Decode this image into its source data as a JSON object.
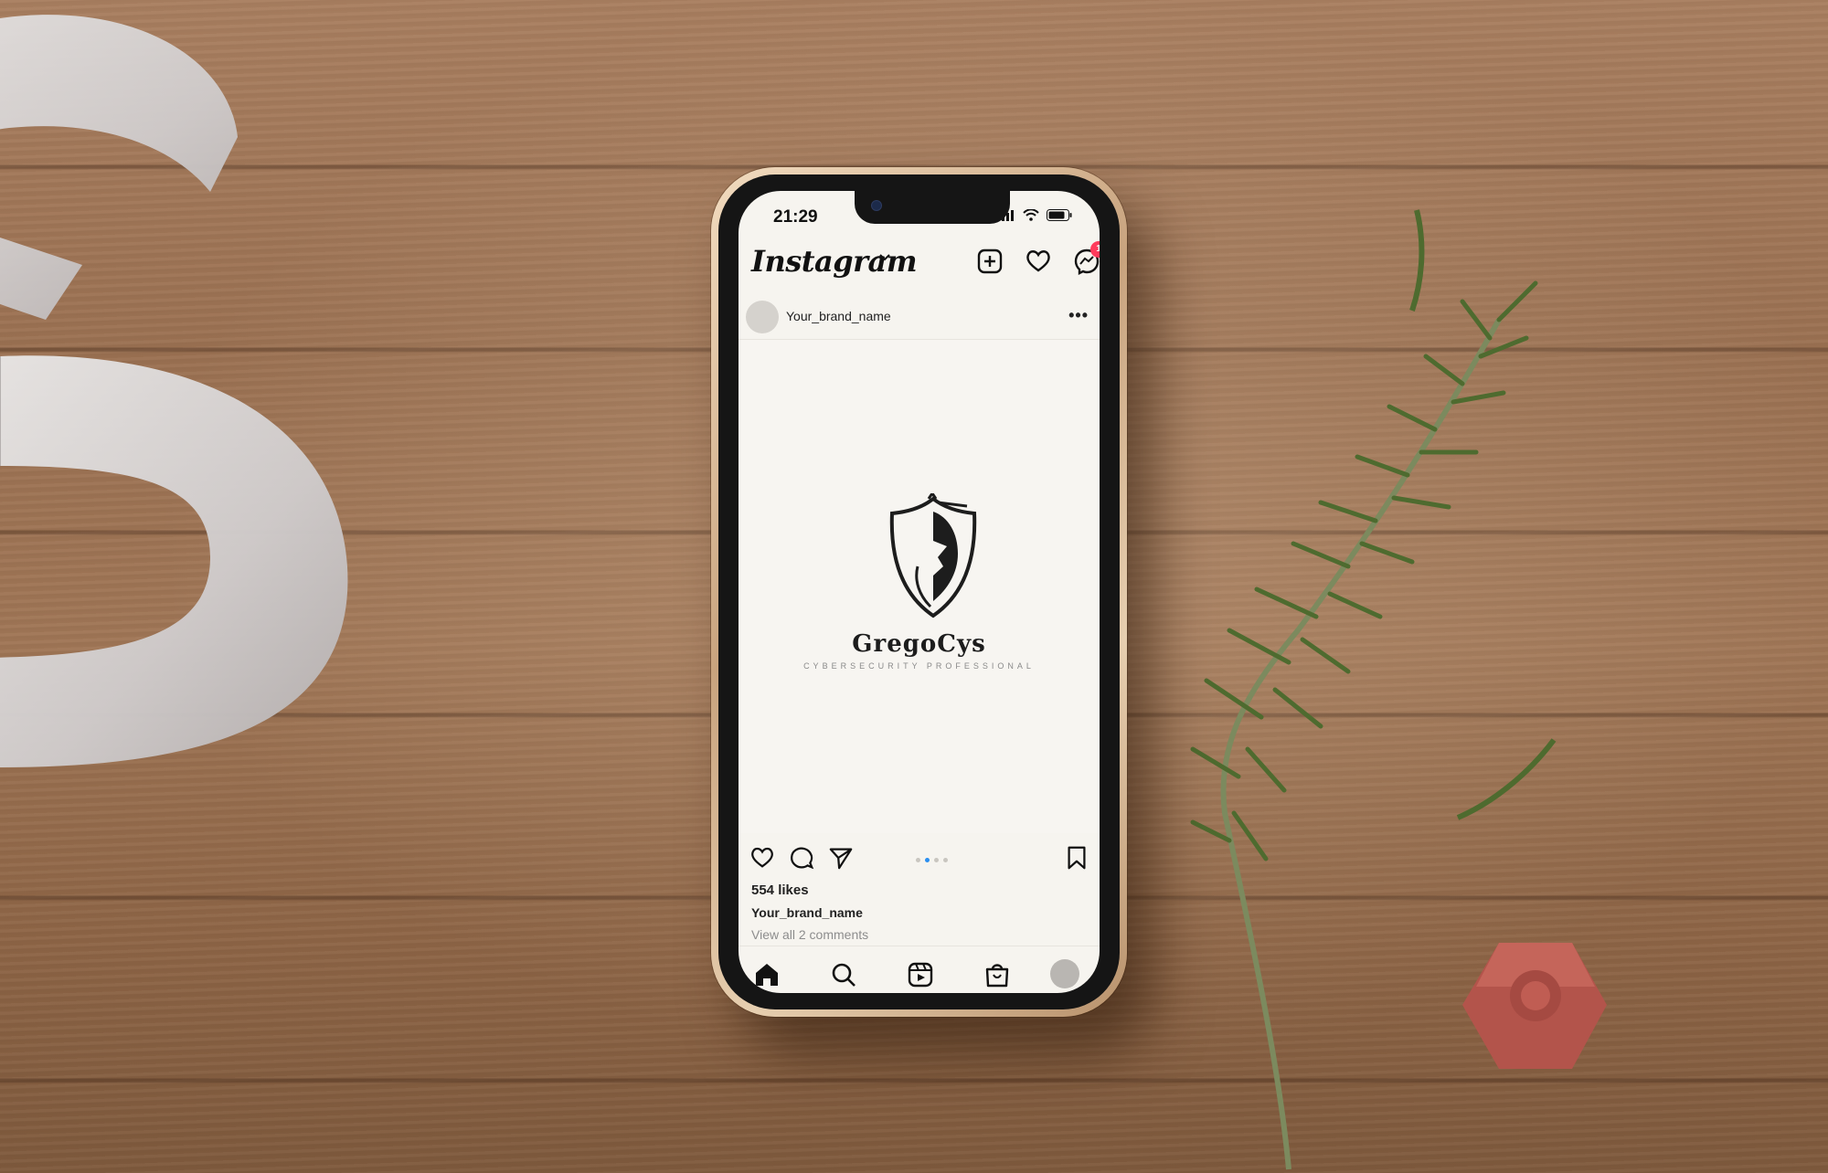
{
  "status_bar": {
    "time": "21:29"
  },
  "app": {
    "name": "Instagram",
    "notification_count": "1"
  },
  "post": {
    "username": "Your_brand_name",
    "more_label": "•••",
    "brand_name": "GregoCys",
    "brand_tagline": "CYBERSECURITY PROFESSIONAL",
    "likes": "554 likes",
    "caption_user": "Your_brand_name",
    "comments_link": "View all 2 comments",
    "carousel": {
      "count": 4,
      "active_index": 1
    }
  },
  "icons": {
    "header": [
      "new-post-icon",
      "heart-icon",
      "messenger-icon"
    ],
    "actions": [
      "like-icon",
      "comment-icon",
      "share-icon",
      "bookmark-icon"
    ],
    "tabbar": [
      "home-icon",
      "search-icon",
      "reels-icon",
      "shop-icon",
      "profile-avatar"
    ]
  },
  "colors": {
    "notification_badge": "#ff3b5c",
    "carousel_active": "#2b8ff0",
    "wood": "#9b7152"
  }
}
